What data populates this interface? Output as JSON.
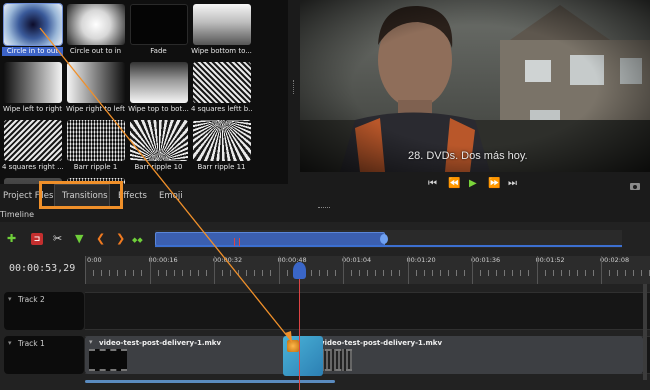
{
  "transitions": [
    {
      "label": "Circle in to out",
      "style": "t-ci",
      "selected": true
    },
    {
      "label": "Circle out to in",
      "style": "t-co"
    },
    {
      "label": "Fade",
      "style": "t-fade"
    },
    {
      "label": "Wipe bottom to...",
      "style": "t-wbt"
    },
    {
      "label": "Wipe left to right",
      "style": "t-wlr"
    },
    {
      "label": "Wipe right to left",
      "style": "t-wrl"
    },
    {
      "label": "Wipe top to bot...",
      "style": "t-wtb"
    },
    {
      "label": "4 squares leftt b...",
      "style": "t-stripe-d"
    },
    {
      "label": "4 squares right ...",
      "style": "t-stripe-d2"
    },
    {
      "label": "Barr ripple 1",
      "style": "t-noise"
    },
    {
      "label": "Barr ripple 10",
      "style": "t-fan"
    },
    {
      "label": "Barr ripple 11",
      "style": "t-fan2"
    }
  ],
  "preview": {
    "subtitle": "28. DVDs. Dos más hoy."
  },
  "controls": {
    "jump_start": "⏮",
    "rewind": "⏪",
    "play": "▶",
    "fast_forward": "⏩",
    "jump_end": "⏭"
  },
  "tabs": [
    "Project Files",
    "Transitions",
    "Effects",
    "Emoji"
  ],
  "timeline": {
    "label": "Timeline",
    "timecode": "00:00:53,29",
    "ruler": [
      "0:00",
      "00:00:16",
      "00:00:32",
      "00:00:48",
      "00:01:04",
      "00:01:20",
      "00:01:36",
      "00:01:52",
      "00:02:08"
    ],
    "toolbar": {
      "add": "✚",
      "snap": "⊐",
      "razor": "✂",
      "marker": "▼",
      "prev_marker": "❮",
      "next_marker": "❯",
      "center": "◆◆"
    },
    "tracks": [
      {
        "name": "Track 2",
        "clips": []
      },
      {
        "name": "Track 1",
        "clips": [
          {
            "title": "video-test-post-delivery-1.mkv"
          },
          {
            "title": "video-test-post-delivery-1.mkv"
          }
        ]
      }
    ]
  },
  "colors": {
    "accent": "#3d64c8",
    "highlight": "#f0902a",
    "play": "#7bd53a",
    "playhead": "#dd4444"
  }
}
